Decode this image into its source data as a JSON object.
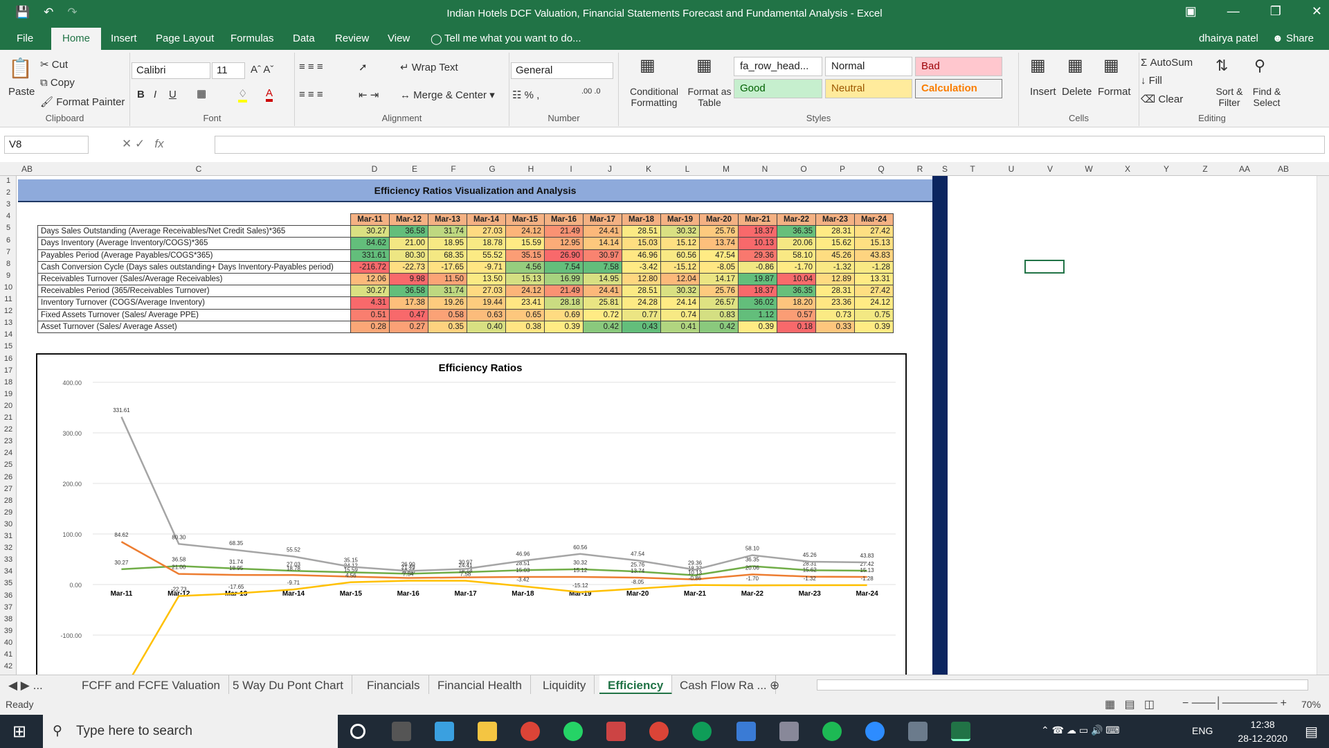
{
  "window": {
    "title": "Indian Hotels DCF Valuation, Financial Statements Forecast and Fundamental Analysis  -  Excel",
    "user": "dhairya patel",
    "share": "Share"
  },
  "tabs": [
    "File",
    "Home",
    "Insert",
    "Page Layout",
    "Formulas",
    "Data",
    "Review",
    "View"
  ],
  "tell_me": "Tell me what you want to do...",
  "ribbon": {
    "clipboard": {
      "paste": "Paste",
      "cut": "Cut",
      "copy": "Copy",
      "format_painter": "Format Painter",
      "label": "Clipboard"
    },
    "font": {
      "name": "Calibri",
      "size": "11",
      "label": "Font"
    },
    "alignment": {
      "wrap": "Wrap Text",
      "merge": "Merge & Center",
      "label": "Alignment"
    },
    "number": {
      "format": "General",
      "label": "Number"
    },
    "styles": {
      "cond": "Conditional Formatting",
      "table": "Format as Table",
      "s1": "fa_row_head...",
      "s2": "Normal",
      "s3": "Bad",
      "s4": "Good",
      "s5": "Neutral",
      "s6": "Calculation",
      "label": "Styles"
    },
    "cells": {
      "insert": "Insert",
      "delete": "Delete",
      "format": "Format",
      "label": "Cells"
    },
    "editing": {
      "autosum": "AutoSum",
      "fill": "Fill",
      "clear": "Clear",
      "sort": "Sort & Filter",
      "find": "Find & Select",
      "label": "Editing"
    }
  },
  "formula_bar": {
    "name_box": "V8",
    "formula": ""
  },
  "columns": [
    "A",
    "B",
    "C",
    "D",
    "E",
    "F",
    "G",
    "H",
    "I",
    "J",
    "K",
    "L",
    "M",
    "N",
    "O",
    "P",
    "Q",
    "R",
    "S",
    "T",
    "U",
    "V",
    "W",
    "X",
    "Y",
    "Z",
    "AA",
    "AB"
  ],
  "sheet": {
    "banner": "Efficiency Ratios Visualization and Analysis",
    "years": [
      "Mar-11",
      "Mar-12",
      "Mar-13",
      "Mar-14",
      "Mar-15",
      "Mar-16",
      "Mar-17",
      "Mar-18",
      "Mar-19",
      "Mar-20",
      "Mar-21",
      "Mar-22",
      "Mar-23",
      "Mar-24"
    ],
    "rows": [
      {
        "label": "Days Sales Outstanding (Average Receivables/Net Credit Sales)*365",
        "values": [
          "30.27",
          "36.58",
          "31.74",
          "27.03",
          "24.12",
          "21.49",
          "24.41",
          "28.51",
          "30.32",
          "25.76",
          "18.37",
          "36.35",
          "28.31",
          "27.42"
        ]
      },
      {
        "label": "Days Inventory  (Average Inventory/COGS)*365",
        "values": [
          "84.62",
          "21.00",
          "18.95",
          "18.78",
          "15.59",
          "12.95",
          "14.14",
          "15.03",
          "15.12",
          "13.74",
          "10.13",
          "20.06",
          "15.62",
          "15.13"
        ]
      },
      {
        "label": "Payables Period (Average Payables/COGS*365)",
        "values": [
          "331.61",
          "80.30",
          "68.35",
          "55.52",
          "35.15",
          "26.90",
          "30.97",
          "46.96",
          "60.56",
          "47.54",
          "29.36",
          "58.10",
          "45.26",
          "43.83"
        ]
      },
      {
        "label": "Cash Conversion Cycle (Days sales outstanding+ Days Inventory-Payables period)",
        "values": [
          "-216.72",
          "-22.73",
          "-17.65",
          "-9.71",
          "4.56",
          "7.54",
          "7.58",
          "-3.42",
          "-15.12",
          "-8.05",
          "-0.86",
          "-1.70",
          "-1.32",
          "-1.28"
        ]
      },
      {
        "label": "Receivables Turnover (Sales/Average Receivables)",
        "values": [
          "12.06",
          "9.98",
          "11.50",
          "13.50",
          "15.13",
          "16.99",
          "14.95",
          "12.80",
          "12.04",
          "14.17",
          "19.87",
          "10.04",
          "12.89",
          "13.31"
        ]
      },
      {
        "label": "Receivables Period (365/Receivables Turnover)",
        "values": [
          "30.27",
          "36.58",
          "31.74",
          "27.03",
          "24.12",
          "21.49",
          "24.41",
          "28.51",
          "30.32",
          "25.76",
          "18.37",
          "36.35",
          "28.31",
          "27.42"
        ]
      },
      {
        "label": "Inventory Turnover (COGS/Average Inventory)",
        "values": [
          "4.31",
          "17.38",
          "19.26",
          "19.44",
          "23.41",
          "28.18",
          "25.81",
          "24.28",
          "24.14",
          "26.57",
          "36.02",
          "18.20",
          "23.36",
          "24.12"
        ]
      },
      {
        "label": "Fixed Assets Turnover (Sales/ Average PPE)",
        "values": [
          "0.51",
          "0.47",
          "0.58",
          "0.63",
          "0.65",
          "0.69",
          "0.72",
          "0.77",
          "0.74",
          "0.83",
          "1.12",
          "0.57",
          "0.73",
          "0.75"
        ]
      },
      {
        "label": "Asset Turnover (Sales/ Average Asset)",
        "values": [
          "0.28",
          "0.27",
          "0.35",
          "0.40",
          "0.38",
          "0.39",
          "0.42",
          "0.43",
          "0.41",
          "0.42",
          "0.39",
          "0.18",
          "0.33",
          "0.39"
        ]
      }
    ]
  },
  "chart_data": {
    "type": "line",
    "title": "Efficiency Ratios",
    "categories": [
      "Mar-11",
      "Mar-12",
      "Mar-13",
      "Mar-14",
      "Mar-15",
      "Mar-16",
      "Mar-17",
      "Mar-18",
      "Mar-19",
      "Mar-20",
      "Mar-21",
      "Mar-22",
      "Mar-23",
      "Mar-24"
    ],
    "ylim": [
      -100,
      400
    ],
    "yticks": [
      "400.00",
      "300.00",
      "200.00",
      "100.00",
      "0.00",
      "-100.00"
    ],
    "series": [
      {
        "color": "#70ad47",
        "values": [
          30.27,
          36.58,
          31.74,
          27.03,
          24.12,
          21.49,
          24.41,
          28.51,
          30.32,
          25.76,
          18.37,
          36.35,
          28.31,
          27.42
        ]
      },
      {
        "color": "#ed7d31",
        "values": [
          84.62,
          21.0,
          18.95,
          18.78,
          15.59,
          12.95,
          14.14,
          15.03,
          15.12,
          13.74,
          10.13,
          20.06,
          15.62,
          15.13
        ]
      },
      {
        "color": "#a5a5a5",
        "values": [
          331.61,
          80.3,
          68.35,
          55.52,
          35.15,
          26.9,
          30.97,
          46.96,
          60.56,
          47.54,
          29.36,
          58.1,
          45.26,
          43.83
        ]
      },
      {
        "color": "#ffc000",
        "values": [
          -216.72,
          -22.73,
          -17.65,
          -9.71,
          4.56,
          7.54,
          7.58,
          -3.42,
          -15.12,
          -8.05,
          -0.86,
          -1.7,
          -1.32,
          -1.28
        ]
      }
    ],
    "grid": true
  },
  "sheet_tabs": [
    "...",
    "FCFF and FCFE Valuation",
    "5 Way Du Pont Chart",
    "Financials",
    "Financial Health",
    "Liquidity",
    "Efficiency",
    "Cash Flow Ra ..."
  ],
  "status": {
    "ready": "Ready",
    "zoom": "70%"
  },
  "taskbar": {
    "search": "Type here to search",
    "lang": "ENG",
    "time": "12:38",
    "date": "28-12-2020"
  }
}
